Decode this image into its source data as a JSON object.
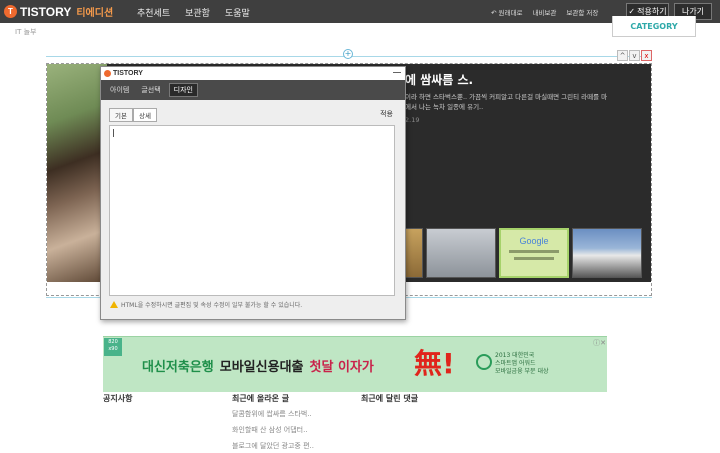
{
  "topbar": {
    "logo_mark": "T",
    "logo": "TISTORY",
    "edition": "티에디션",
    "nav": [
      "추천세트",
      "보관함",
      "도움말"
    ],
    "right_links": [
      "원래대로",
      "내비보관",
      "보관함 저장"
    ],
    "apply_label": "적용하기",
    "exit_label": "나가기"
  },
  "breadcrumb": "IT 놀부",
  "category_button": "CATEGORY",
  "module_controls": [
    "^",
    "v",
    "x"
  ],
  "slide": {
    "title": "에 쌈싸름 스.",
    "description": "이라 하면 스타벅스뿐.. 가끔씩 커피알고 다른걸 마실때면 그린티 라떼를 마\n에서 나는 녹차 일종에 유기..",
    "date": "2.19"
  },
  "thumb_google": "Google",
  "editor": {
    "title": "TISTORY",
    "tabs": [
      "아이템",
      "글선택",
      "디자인"
    ],
    "subtabs": [
      "기본",
      "상세"
    ],
    "apply": "적용",
    "note": "HTML을 수정하시면 글편집 및 속성 수정이 일부 불가능 할 수 있습니다."
  },
  "ad": {
    "badge": "820\nx90",
    "text1": "대신저축은행",
    "text2": "모바일신용대출",
    "text3": "첫달 이자가",
    "big": "無!",
    "award": "2013 대한민국\n스마트앱 어워드\n모바일금융 부문 대상"
  },
  "footer": {
    "col1": "공지사항",
    "col2": "최근에 올라온 글",
    "col3": "최근에 달린 댓글",
    "recent_posts": [
      "달콤함위에 쌉싸름 스타벅..",
      "화인할때 산 삼성 어댑터..",
      "블로그에 달았던 광고중 편.."
    ]
  }
}
